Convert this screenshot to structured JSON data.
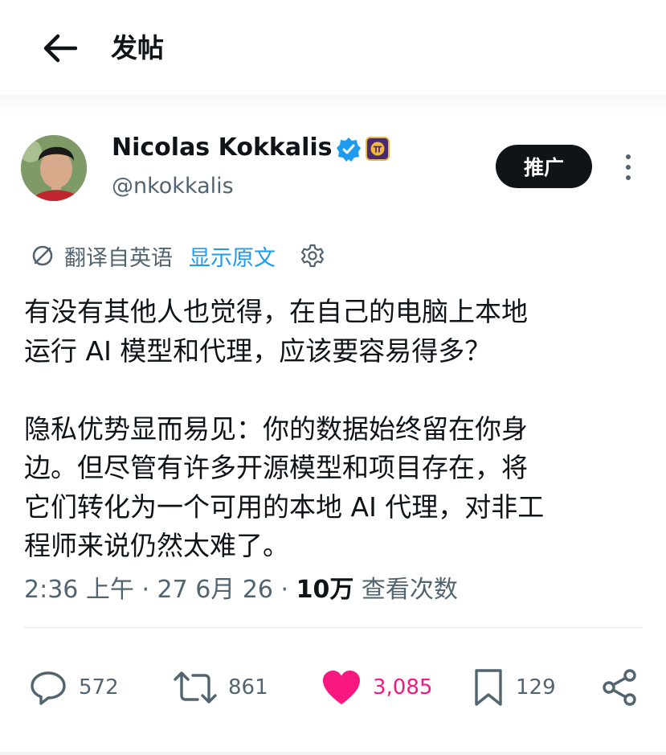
{
  "header": {
    "title": "发帖",
    "back_icon": "arrow-left-icon"
  },
  "author": {
    "name": "Nicolas Kokkalis",
    "handle": "@nkokkalis",
    "verified_color": "#1d9bf0",
    "affiliate_badge_color": "#4a2a6e"
  },
  "promo_button": {
    "label": "推广"
  },
  "translation": {
    "label": "翻译自英语",
    "show_original": "显示原文"
  },
  "tweet": {
    "text": "有没有其他人也觉得，在自己的电脑上本地\n运行 AI 模型和代理，应该要容易得多？\n\n隐私优势显而易见：你的数据始终留在你身\n边。但尽管有许多开源模型和项目存在，将\n它们转化为一个可用的本地 AI 代理，对非工\n程师来说仍然太难了。"
  },
  "meta": {
    "time_date": "2:36 上午 · 27 6月 26 · ",
    "views_count": "10万",
    "views_label": " 查看次数"
  },
  "actions": {
    "replies": "572",
    "reposts": "861",
    "likes": "3,085",
    "bookmarks": "129"
  },
  "colors": {
    "like": "#f91880",
    "link": "#1d9bf0",
    "muted": "#536471",
    "text": "#0f1419"
  }
}
